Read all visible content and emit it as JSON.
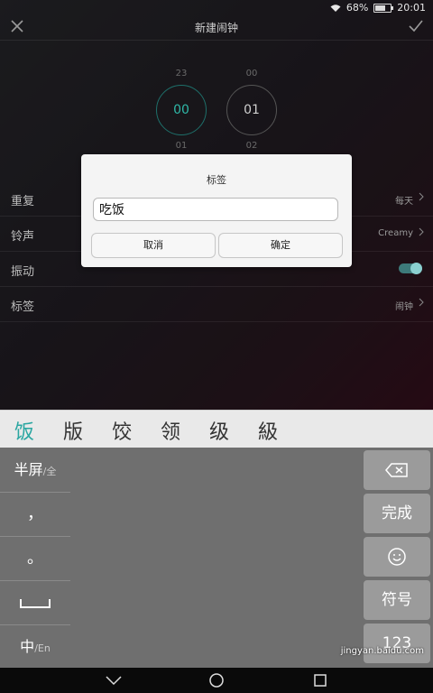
{
  "status_bar": {
    "battery": "68%",
    "time": "20:01"
  },
  "title_bar": {
    "title": "新建闹钟"
  },
  "time_picker": {
    "hour": {
      "prev": "23",
      "current": "00",
      "next": "01"
    },
    "minute": {
      "prev": "00",
      "current": "01",
      "next": "02"
    }
  },
  "settings": {
    "repeat": {
      "label": "重复",
      "value": "每天"
    },
    "ringtone": {
      "label": "铃声",
      "value": "Creamy"
    },
    "vibrate": {
      "label": "振动",
      "on": true
    },
    "tag": {
      "label": "标签",
      "value": "闹钟"
    }
  },
  "dialog": {
    "title": "标签",
    "input_value": "吃饭",
    "cancel": "取消",
    "confirm": "确定"
  },
  "candidates": [
    "饭",
    "版",
    "饺",
    "领",
    "级",
    "級"
  ],
  "keyboard": {
    "half_screen": "半屏",
    "half_screen_sub": "/全",
    "comma": "，",
    "period": "。",
    "space": "␣",
    "lang": "中",
    "lang_sub": "/En",
    "done": "完成",
    "symbol": "符号",
    "num": "123"
  },
  "watermark": "jingyan.baidu.com",
  "colors": {
    "accent": "#2aa6a1",
    "toggle": "#3d7a7a"
  }
}
